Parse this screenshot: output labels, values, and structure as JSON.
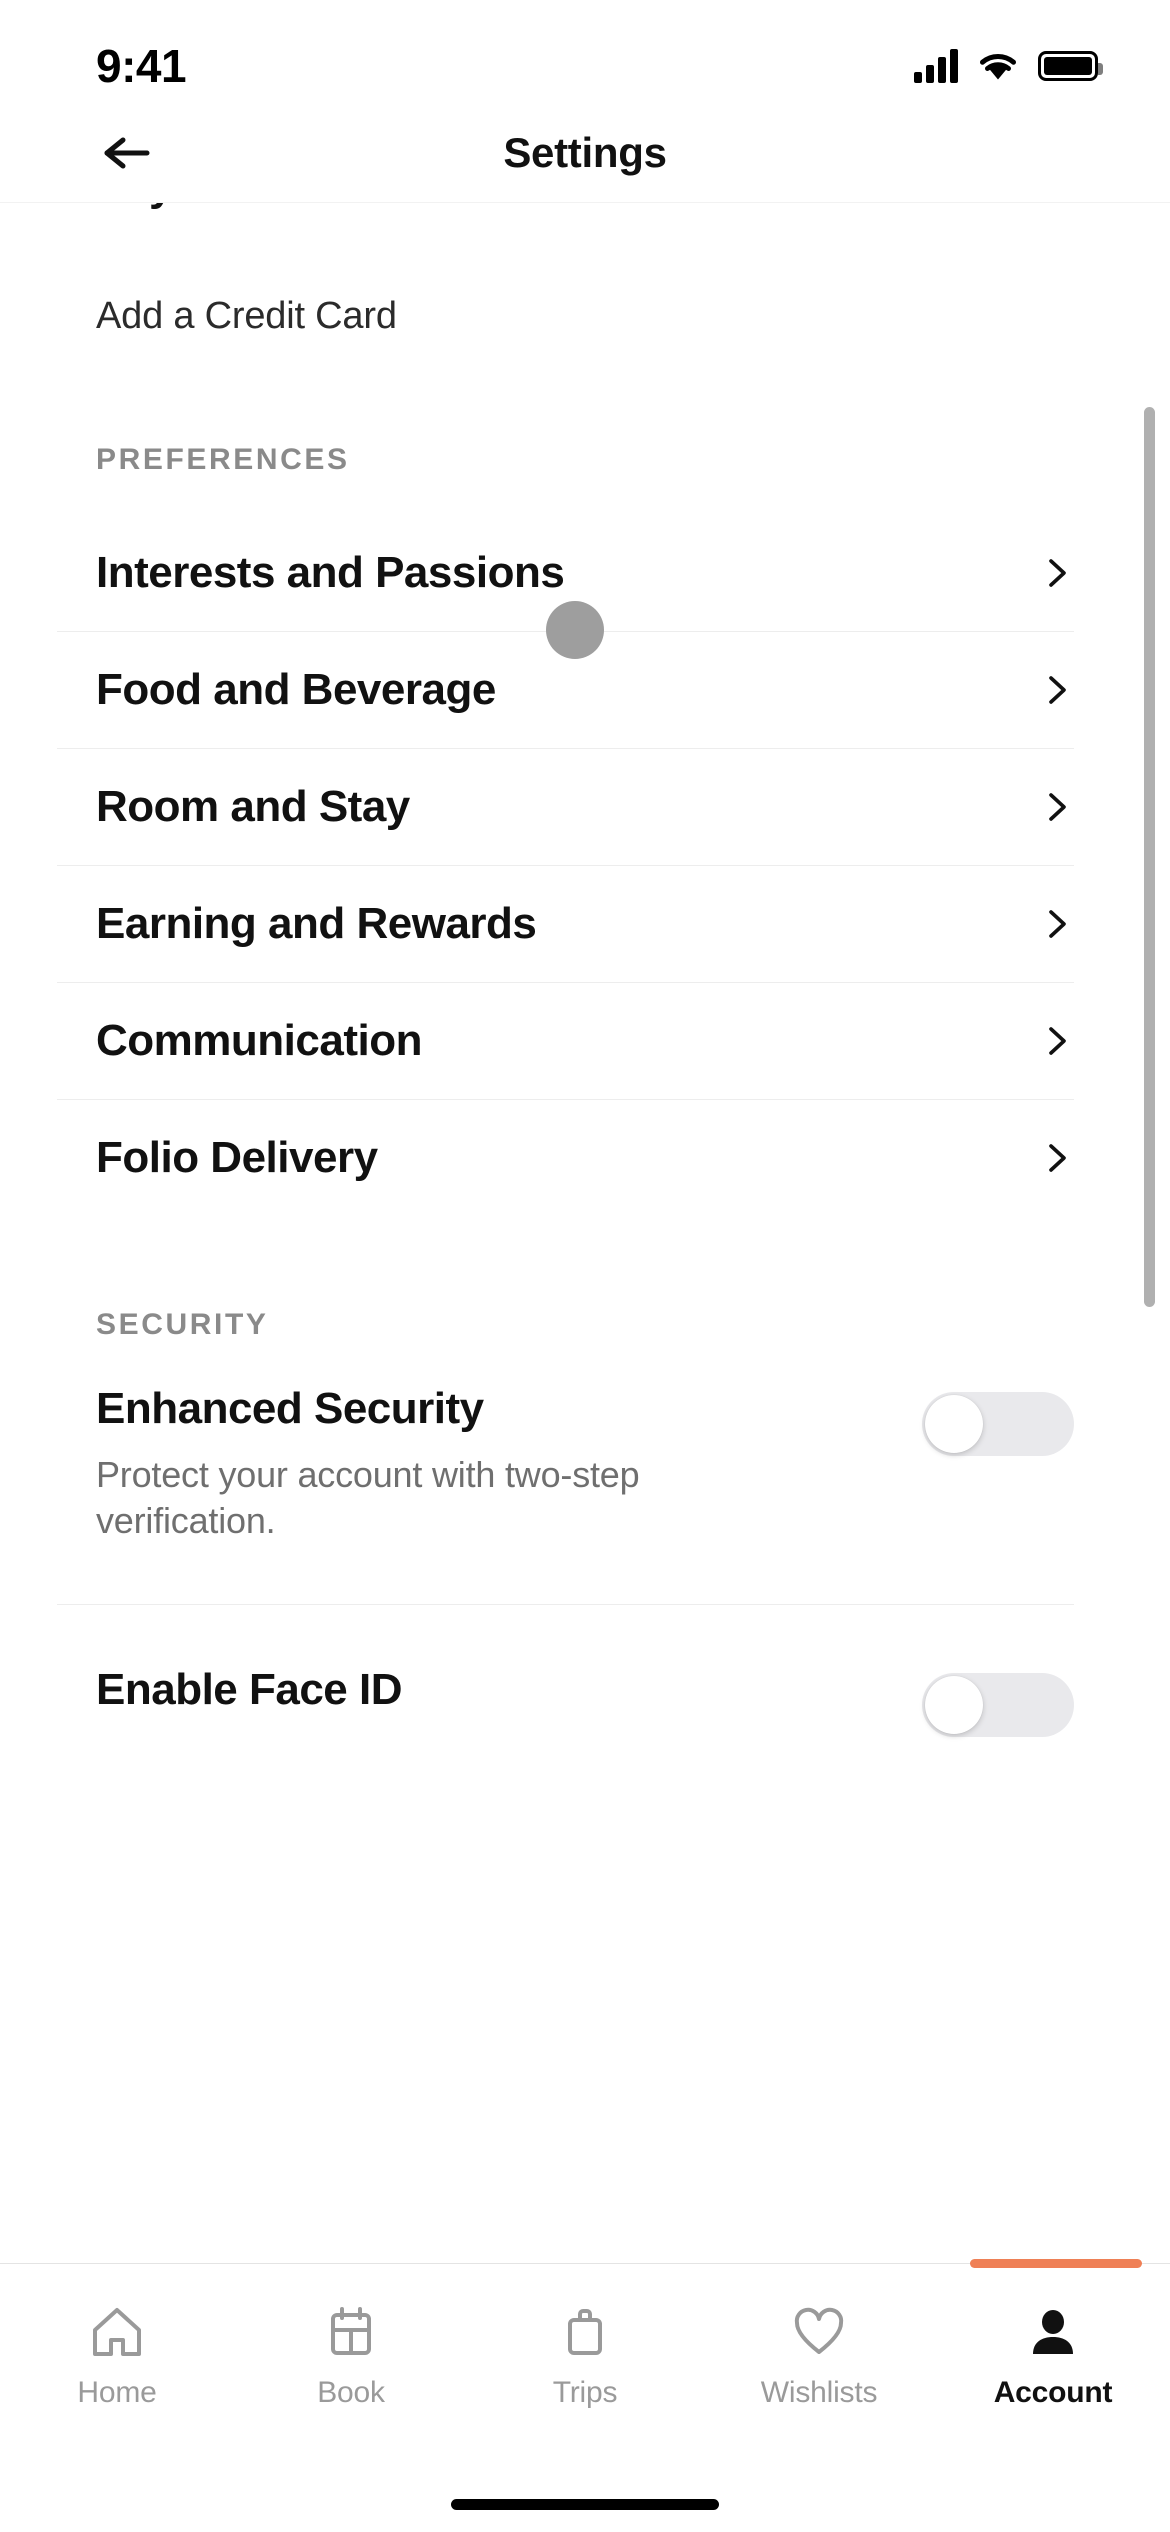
{
  "status_bar": {
    "time": "9:41",
    "icons": [
      "cellular-signal-icon",
      "wifi-icon",
      "battery-icon"
    ]
  },
  "header": {
    "back_icon": "arrow-left-icon",
    "title": "Settings"
  },
  "content": {
    "clipped_section": {
      "title": "Payment Information",
      "chevron": "chevron-right-icon",
      "subtitle": "Add a Credit Card"
    },
    "preferences": {
      "label": "PREFERENCES",
      "items": [
        {
          "label": "Interests and Passions",
          "chevron": "chevron-right-icon"
        },
        {
          "label": "Food and Beverage",
          "chevron": "chevron-right-icon"
        },
        {
          "label": "Room and Stay",
          "chevron": "chevron-right-icon"
        },
        {
          "label": "Earning and Rewards",
          "chevron": "chevron-right-icon"
        },
        {
          "label": "Communication",
          "chevron": "chevron-right-icon"
        },
        {
          "label": "Folio Delivery",
          "chevron": "chevron-right-icon"
        }
      ]
    },
    "security": {
      "label": "SECURITY",
      "items": [
        {
          "title": "Enhanced Security",
          "subtitle": "Protect your account with two-step verification.",
          "toggle_state": "off"
        },
        {
          "title": "Enable Face ID",
          "subtitle": "",
          "toggle_state": "off"
        }
      ]
    }
  },
  "tab_bar": {
    "active_tab": "Account",
    "tabs": [
      {
        "label": "Home",
        "icon": "home-icon"
      },
      {
        "label": "Book",
        "icon": "calendar-icon"
      },
      {
        "label": "Trips",
        "icon": "briefcase-icon"
      },
      {
        "label": "Wishlists",
        "icon": "heart-icon"
      },
      {
        "label": "Account",
        "icon": "person-icon"
      }
    ]
  },
  "colors": {
    "accent_orange": "#ef8056",
    "text_primary": "#111111",
    "text_secondary": "#6f6f6f",
    "section_label": "#8a8a8a",
    "divider": "#ededed",
    "toggle_track_off": "#e9e9ec",
    "scrollbar": "#b0b0b0",
    "cursor": "#9e9e9e"
  }
}
